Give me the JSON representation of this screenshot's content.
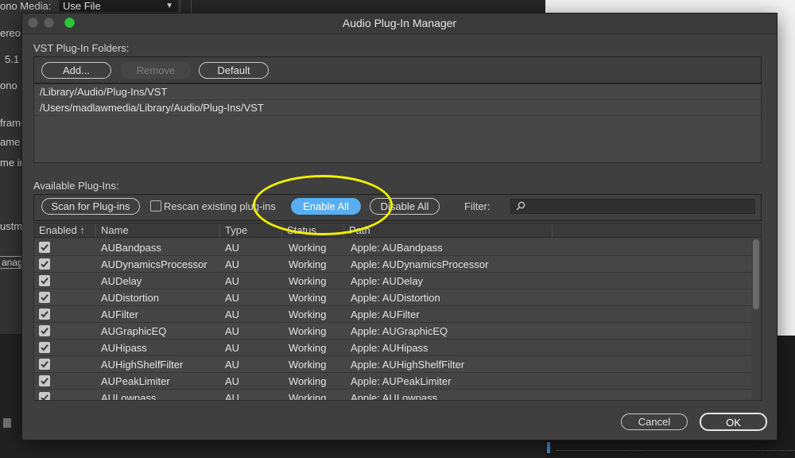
{
  "background": {
    "left_labels": [
      "ono Media:",
      "ereo",
      "5.1",
      "ono",
      "frame",
      "ame",
      "me ir",
      "ustm",
      "anag"
    ],
    "select_value": "Use File"
  },
  "dialog": {
    "title": "Audio Plug-In Manager",
    "vst": {
      "section_label": "VST Plug-In Folders:",
      "add_label": "Add...",
      "remove_label": "Remove",
      "default_label": "Default",
      "folders": [
        "/Library/Audio/Plug-Ins/VST",
        "/Users/madlawmedia/Library/Audio/Plug-Ins/VST"
      ]
    },
    "available": {
      "section_label": "Available Plug-Ins:",
      "scan_label": "Scan for Plug-ins",
      "rescan_label": "Rescan existing plug-ins",
      "enable_all_label": "Enable All",
      "disable_all_label": "Disable All",
      "filter_label": "Filter:",
      "filter_value": ""
    },
    "table": {
      "headers": {
        "enabled": "Enabled",
        "sort_arrow": "↑",
        "name": "Name",
        "type": "Type",
        "status": "Status",
        "path": "Path"
      },
      "rows": [
        {
          "enabled": true,
          "name": "AUBandpass",
          "type": "AU",
          "status": "Working",
          "path": "Apple: AUBandpass"
        },
        {
          "enabled": true,
          "name": "AUDynamicsProcessor",
          "type": "AU",
          "status": "Working",
          "path": "Apple: AUDynamicsProcessor"
        },
        {
          "enabled": true,
          "name": "AUDelay",
          "type": "AU",
          "status": "Working",
          "path": "Apple: AUDelay"
        },
        {
          "enabled": true,
          "name": "AUDistortion",
          "type": "AU",
          "status": "Working",
          "path": "Apple: AUDistortion"
        },
        {
          "enabled": true,
          "name": "AUFilter",
          "type": "AU",
          "status": "Working",
          "path": "Apple: AUFilter"
        },
        {
          "enabled": true,
          "name": "AUGraphicEQ",
          "type": "AU",
          "status": "Working",
          "path": "Apple: AUGraphicEQ"
        },
        {
          "enabled": true,
          "name": "AUHipass",
          "type": "AU",
          "status": "Working",
          "path": "Apple: AUHipass"
        },
        {
          "enabled": true,
          "name": "AUHighShelfFilter",
          "type": "AU",
          "status": "Working",
          "path": "Apple: AUHighShelfFilter"
        },
        {
          "enabled": true,
          "name": "AUPeakLimiter",
          "type": "AU",
          "status": "Working",
          "path": "Apple: AUPeakLimiter"
        },
        {
          "enabled": true,
          "name": "AULowpass",
          "type": "AU",
          "status": "Working",
          "path": "Apple: AULowpass"
        }
      ]
    },
    "footer": {
      "cancel_label": "Cancel",
      "ok_label": "OK"
    },
    "colors": {
      "accent": "#58aef0",
      "annotation": "#f2f000",
      "zoom_button": "#2ec83e"
    }
  }
}
